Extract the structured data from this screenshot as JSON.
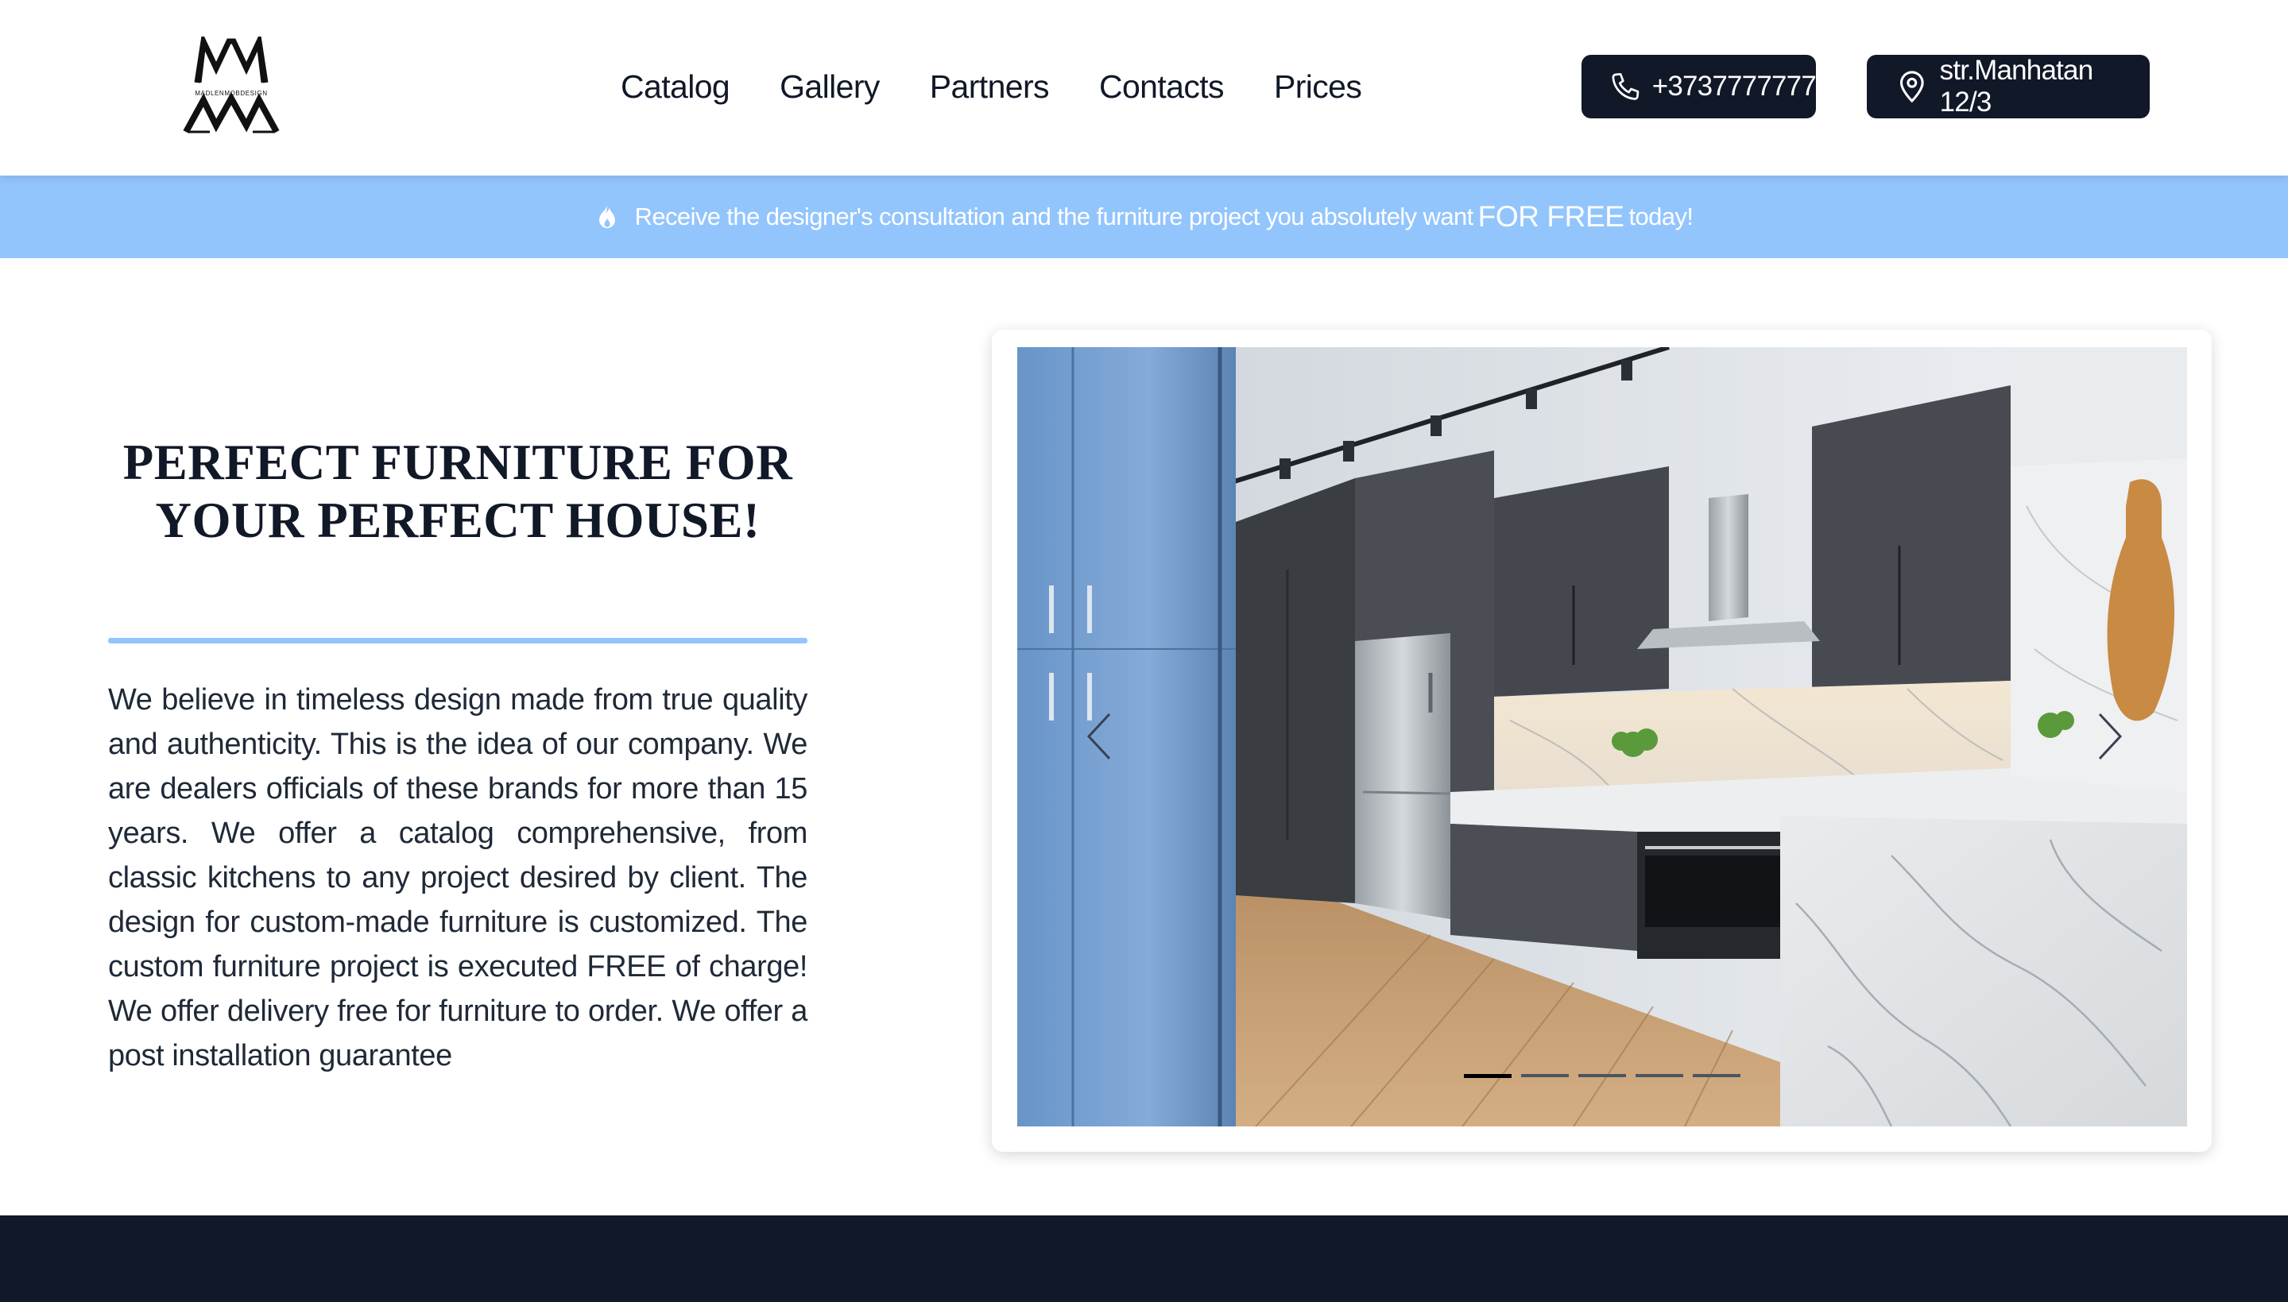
{
  "header": {
    "logo": {
      "text": "MADLENMOBDESIGN",
      "monogram": "MM"
    },
    "nav": [
      {
        "label": "Catalog"
      },
      {
        "label": "Gallery"
      },
      {
        "label": "Partners"
      },
      {
        "label": "Contacts"
      },
      {
        "label": "Prices"
      }
    ],
    "phone": {
      "icon": "phone-icon",
      "label": "+3737777777"
    },
    "address": {
      "icon": "location-pin-icon",
      "label": "str.Manhatan 12/3"
    }
  },
  "promo": {
    "icon": "flame-icon",
    "text_before": "Receive the designer's consultation and the furniture project you absolutely want",
    "text_strong": "FOR FREE",
    "text_after": "today!"
  },
  "hero": {
    "title": "PERFECT FURNITURE FOR YOUR PERFECT HOUSE!",
    "text": "We believe in timeless design made from true quality and authenticity. This is the idea of our company. We are dealers officials of these brands for more than 15 years. We offer a catalog comprehensive, from classic kitchens to any project desired by client. The design for custom-made furniture is customized. The custom furniture project is executed FREE of charge! We offer delivery free for furniture to order. We offer a post installation guarantee"
  },
  "slider": {
    "prev_icon": "chevron-left-icon",
    "next_icon": "chevron-right-icon",
    "slide_count": 5,
    "active_index": 0
  },
  "colors": {
    "dark": "#111827",
    "accent": "#93c5fd",
    "white": "#ffffff"
  }
}
